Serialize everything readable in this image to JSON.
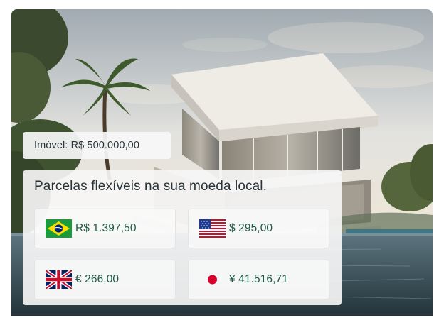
{
  "hero": {
    "image_icon": "modern-house-photo"
  },
  "price_tag": {
    "label": "Imóvel: R$ 500.000,00"
  },
  "panel": {
    "title": "Parcelas flexíveis na sua moeda local.",
    "currencies": [
      {
        "flag_icon": "brazil-flag-icon",
        "value": "R$ 1.397,50"
      },
      {
        "flag_icon": "usa-flag-icon",
        "value": "$ 295,00"
      },
      {
        "flag_icon": "uk-flag-icon",
        "value": "€ 266,00"
      },
      {
        "flag_icon": "japan-flag-icon",
        "value": "¥ 41.516,71"
      }
    ]
  },
  "colors": {
    "value_text": "#1e5a44",
    "panel_bg": "#f6f6f6"
  }
}
